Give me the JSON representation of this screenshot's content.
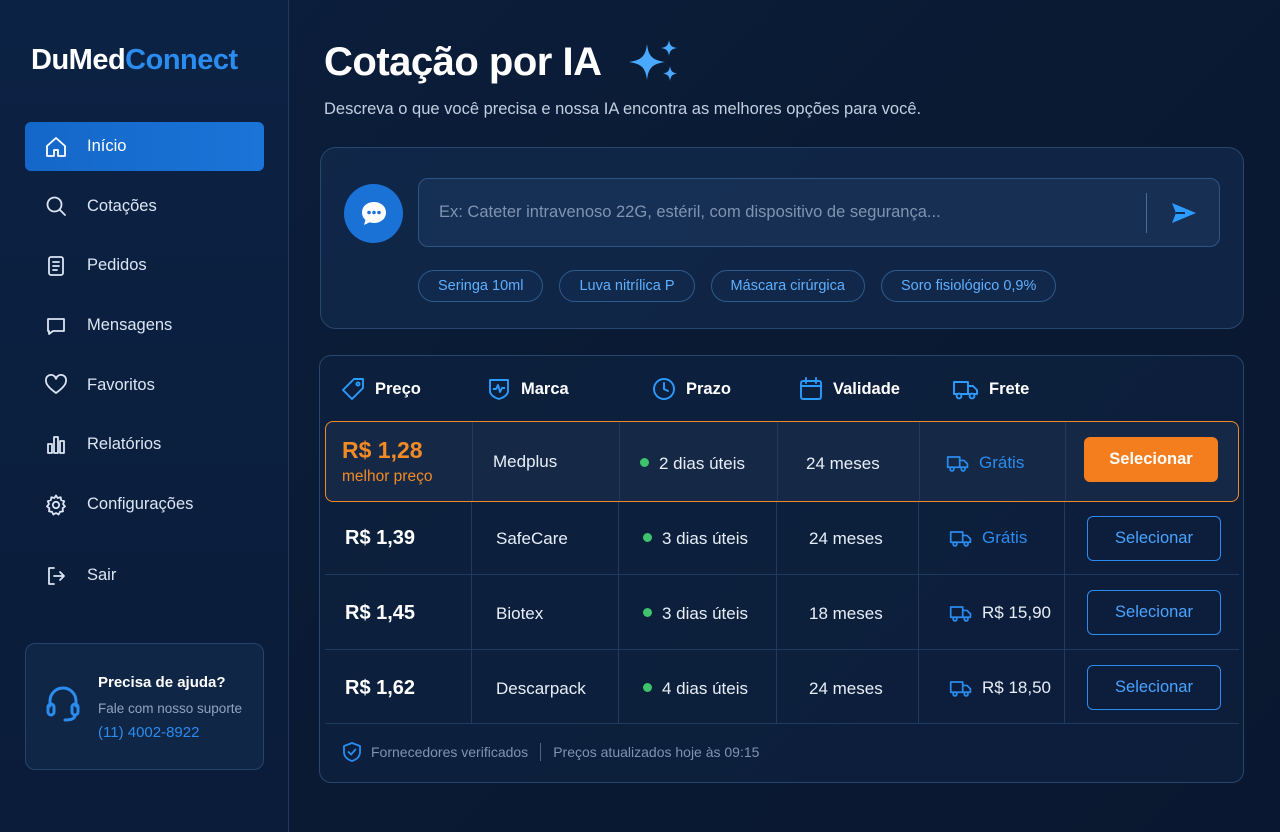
{
  "brand": {
    "part1": "DuMed",
    "part2": "Connect"
  },
  "sidebar": {
    "items": [
      {
        "label": "Início",
        "icon": "home-icon"
      },
      {
        "label": "Cotações",
        "icon": "search-icon"
      },
      {
        "label": "Pedidos",
        "icon": "document-icon"
      },
      {
        "label": "Mensagens",
        "icon": "chat-icon"
      },
      {
        "label": "Favoritos",
        "icon": "heart-icon"
      },
      {
        "label": "Relatórios",
        "icon": "bar-chart-icon"
      },
      {
        "label": "Configurações",
        "icon": "gear-icon"
      }
    ],
    "logout": "Sair"
  },
  "help": {
    "title": "Precisa de ajuda?",
    "subtitle": "Fale com nosso suporte",
    "phone": "(11) 4002-8922"
  },
  "page": {
    "title": "Cotação por IA",
    "subtitle": "Descreva o que você precisa e nossa IA encontra as melhores opções para você."
  },
  "ask": {
    "placeholder": "Ex: Cateter intravenoso 22G, estéril, com dispositivo de segurança...",
    "chips": [
      "Seringa 10ml",
      "Luva nitrílica P",
      "Máscara cirúrgica",
      "Soro fisiológico 0,9%"
    ]
  },
  "table": {
    "headers": {
      "price": "Preço",
      "brand": "Marca",
      "term": "Prazo",
      "validity": "Validade",
      "freight": "Frete"
    },
    "best_label": "melhor preço",
    "select_label": "Selecionar",
    "rows": [
      {
        "price": "R$ 1,28",
        "brand": "Medplus",
        "term": "2 dias úteis",
        "validity": "24 meses",
        "freight": "Grátis"
      },
      {
        "price": "R$ 1,39",
        "brand": "SafeCare",
        "term": "3 dias úteis",
        "validity": "24 meses",
        "freight": "Grátis"
      },
      {
        "price": "R$ 1,45",
        "brand": "Biotex",
        "term": "3 dias úteis",
        "validity": "18 meses",
        "freight": "R$ 15,90"
      },
      {
        "price": "R$ 1,62",
        "brand": "Descarpack",
        "term": "4 dias úteis",
        "validity": "24 meses",
        "freight": "R$ 18,50"
      }
    ],
    "footer": {
      "verified": "Fornecedores verificados",
      "updated": "Preços atualizados hoje às 09:15"
    }
  },
  "colors": {
    "accent": "#2b8cf0",
    "best": "#f28a25",
    "ok": "#3ec46d",
    "bg": "#0a1a33"
  }
}
